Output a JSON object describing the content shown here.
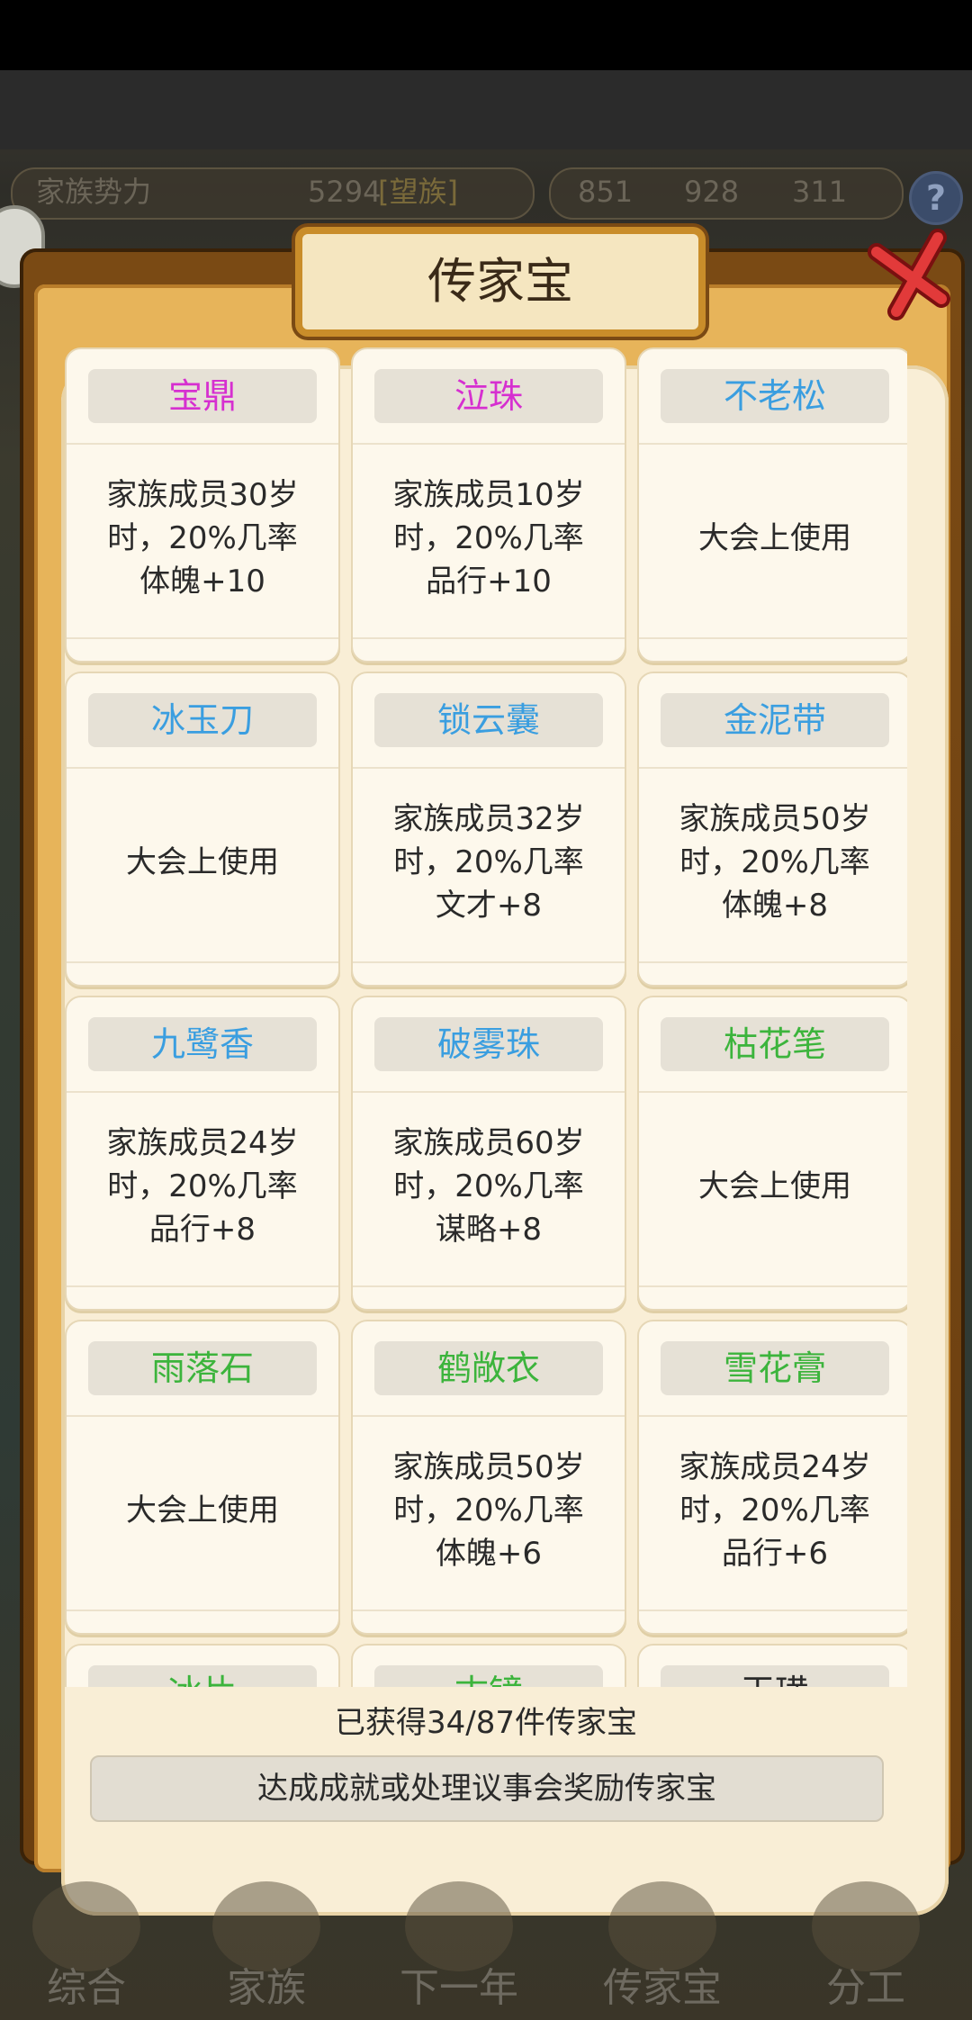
{
  "topbar": {
    "family_power_label": "家族势力",
    "family_power_value": "5294",
    "rank_badge": "[望族]",
    "resource_1": "851",
    "resource_2": "928",
    "resource_3": "311",
    "help_icon": "?"
  },
  "modal": {
    "title": "传家宝",
    "close_icon": "close-icon"
  },
  "items": [
    {
      "name": "宝鼎",
      "color": "#d62fd0",
      "desc": "家族成员30岁\n时，20%几率\n体魄+10"
    },
    {
      "name": "泣珠",
      "color": "#d62fd0",
      "desc": "家族成员10岁\n时，20%几率\n品行+10"
    },
    {
      "name": "不老松",
      "color": "#3a9ee0",
      "desc": "大会上使用"
    },
    {
      "name": "冰玉刀",
      "color": "#3a9ee0",
      "desc": "大会上使用"
    },
    {
      "name": "锁云囊",
      "color": "#3a9ee0",
      "desc": "家族成员32岁\n时，20%几率\n文才+8"
    },
    {
      "name": "金泥带",
      "color": "#3a9ee0",
      "desc": "家族成员50岁\n时，20%几率\n体魄+8"
    },
    {
      "name": "九鹭香",
      "color": "#3a9ee0",
      "desc": "家族成员24岁\n时，20%几率\n品行+8"
    },
    {
      "name": "破雾珠",
      "color": "#3a9ee0",
      "desc": "家族成员60岁\n时，20%几率\n谋略+8"
    },
    {
      "name": "枯花笔",
      "color": "#3cb43c",
      "desc": "大会上使用"
    },
    {
      "name": "雨落石",
      "color": "#3cb43c",
      "desc": "大会上使用"
    },
    {
      "name": "鹤敞衣",
      "color": "#3cb43c",
      "desc": "家族成员50岁\n时，20%几率\n体魄+6"
    },
    {
      "name": "雪花膏",
      "color": "#3cb43c",
      "desc": "家族成员24岁\n时，20%几率\n品行+6"
    },
    {
      "name": "冰片",
      "color": "#3cb43c",
      "desc": ""
    },
    {
      "name": "古镜",
      "color": "#3cb43c",
      "desc": ""
    },
    {
      "name": "玉璜",
      "color": "#2a2a2a",
      "desc": ""
    }
  ],
  "footer": {
    "count_text": "已获得34/87件传家宝",
    "achieve_button": "达成成就或处理议事会奖励传家宝"
  },
  "nav": [
    {
      "label": "综合"
    },
    {
      "label": "家族"
    },
    {
      "label": "下一年"
    },
    {
      "label": "传家宝"
    },
    {
      "label": "分工"
    }
  ]
}
